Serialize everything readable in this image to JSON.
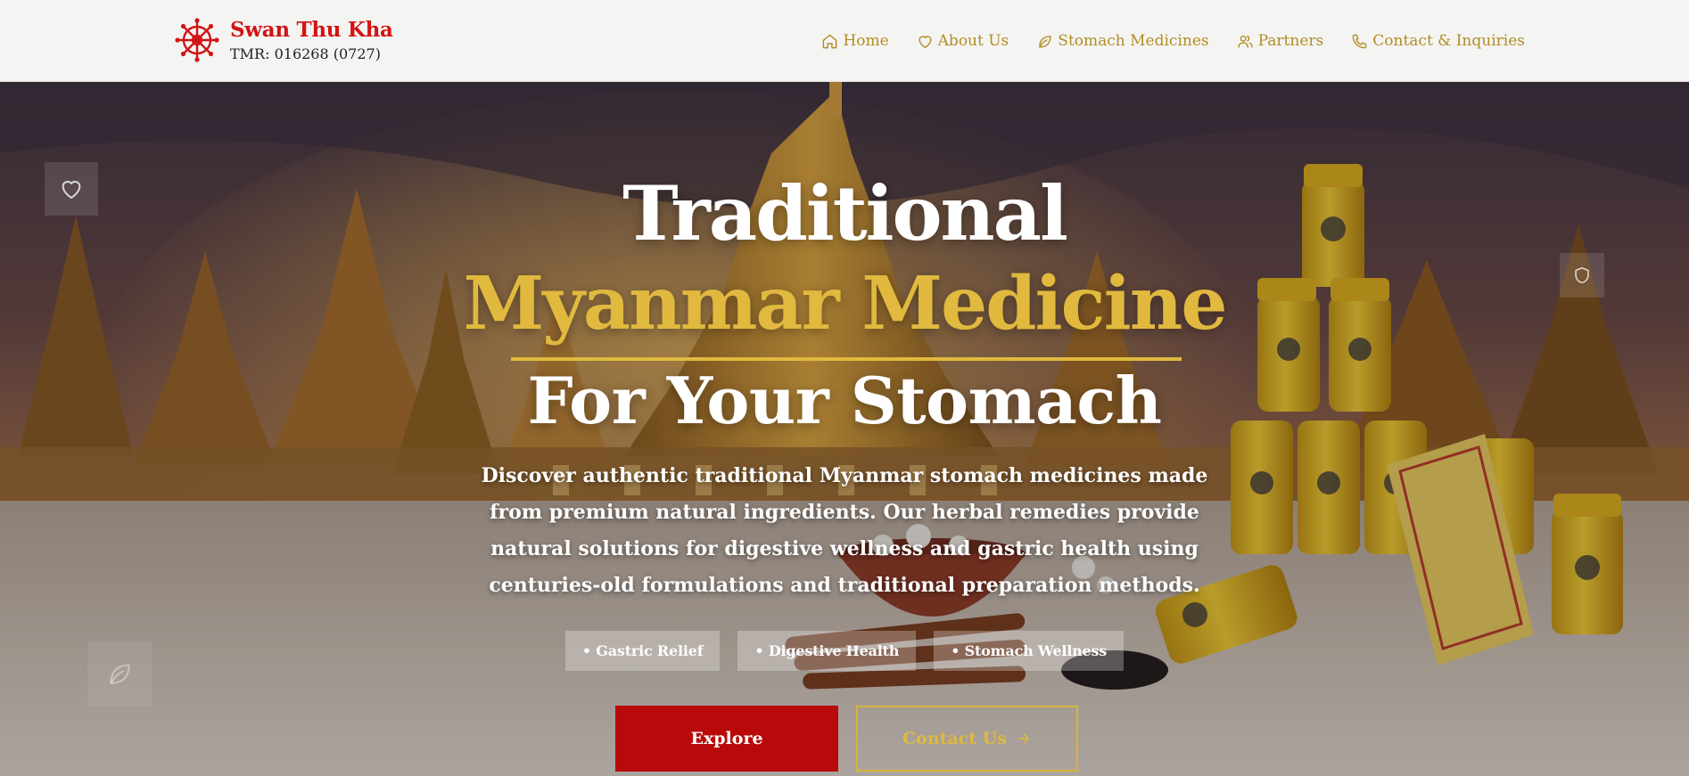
{
  "brand": {
    "name": "Swan Thu Kha",
    "tmr": "TMR: 016268 (0727)",
    "color": "#d21414"
  },
  "nav": {
    "items": [
      {
        "label": "Home",
        "icon": "home-icon"
      },
      {
        "label": "About Us",
        "icon": "heart-icon"
      },
      {
        "label": "Stomach Medicines",
        "icon": "leaf-icon"
      },
      {
        "label": "Partners",
        "icon": "users-icon"
      },
      {
        "label": "Contact & Inquiries",
        "icon": "phone-icon"
      }
    ],
    "color": "#b28d24"
  },
  "hero": {
    "title_line1": "Traditional",
    "title_line2": "Myanmar Medicine",
    "title_line3": "For Your Stomach",
    "description": "Discover authentic traditional Myanmar stomach medicines made from premium natural ingredients. Our herbal remedies provide natural solutions for digestive wellness and gastric health using centuries-old formulations and traditional preparation methods.",
    "tags": [
      "• Gastric Relief",
      "• Digestive Health",
      "• Stomach Wellness"
    ],
    "explore_label": "Explore",
    "contact_label": "Contact Us",
    "accent_gold": "#e0b93e",
    "accent_red": "#b80a0a"
  },
  "floating_icons": [
    "heart-icon",
    "shield-icon",
    "leaf-icon"
  ]
}
